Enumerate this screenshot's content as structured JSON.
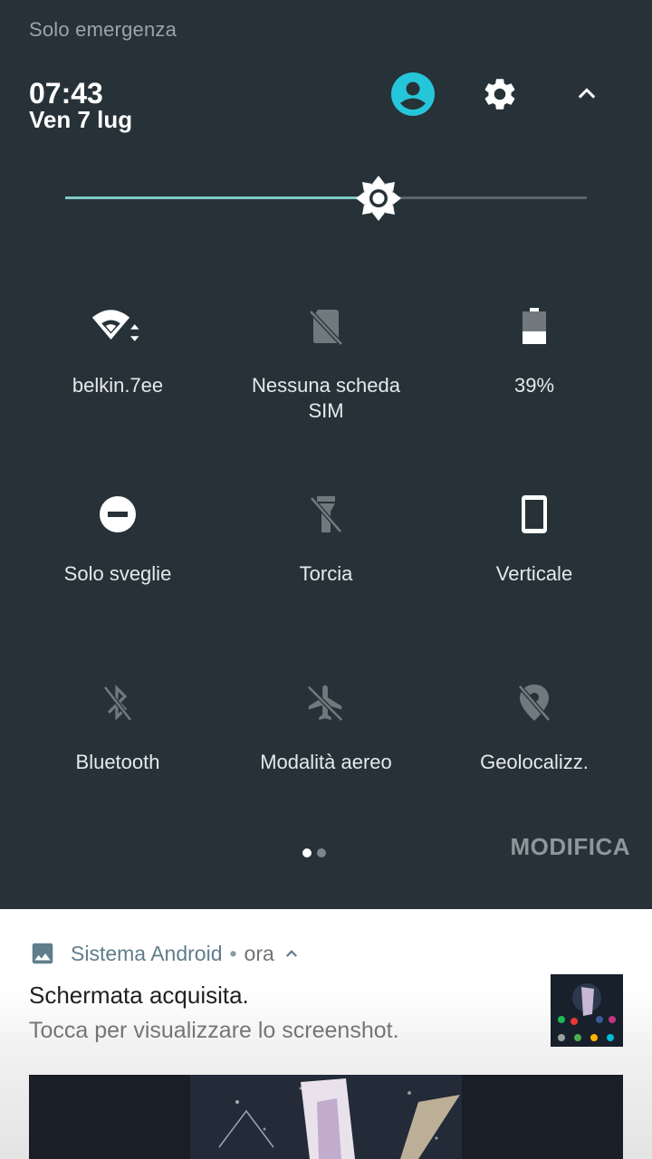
{
  "status": {
    "carrier_text": "Solo emergenza"
  },
  "header": {
    "time": "07:43",
    "date": "Ven 7 lug",
    "user_icon": "account-circle-icon",
    "settings_icon": "gear-icon",
    "collapse_icon": "chevron-up-icon",
    "accent_color": "#26c6da"
  },
  "brightness": {
    "level_percent": 60,
    "fill_color": "#80cbc4"
  },
  "tiles": [
    {
      "label": "belkin.7ee",
      "icon": "wifi-icon",
      "active": true
    },
    {
      "label": "Nessuna scheda",
      "label2": "SIM",
      "icon": "no-sim-icon",
      "active": false
    },
    {
      "label": "39%",
      "icon": "battery-icon",
      "active": true
    },
    {
      "label": "Solo sveglie",
      "icon": "do-not-disturb-icon",
      "active": true
    },
    {
      "label": "Torcia",
      "icon": "flashlight-off-icon",
      "active": false
    },
    {
      "label": "Verticale",
      "icon": "portrait-rotation-icon",
      "active": true
    },
    {
      "label": "Bluetooth",
      "icon": "bluetooth-off-icon",
      "active": false
    },
    {
      "label": "Modalità aereo",
      "icon": "airplane-off-icon",
      "active": false
    },
    {
      "label": "Geolocalizz.",
      "icon": "location-off-icon",
      "active": false
    }
  ],
  "pager": {
    "pages": 2,
    "current": 1
  },
  "edit_label": "MODIFICA",
  "notification": {
    "app_icon": "image-icon",
    "app_name": "Sistema Android",
    "separator": "•",
    "when": "ora",
    "title": "Schermata acquisita.",
    "text": "Tocca per visualizzare lo screenshot."
  }
}
